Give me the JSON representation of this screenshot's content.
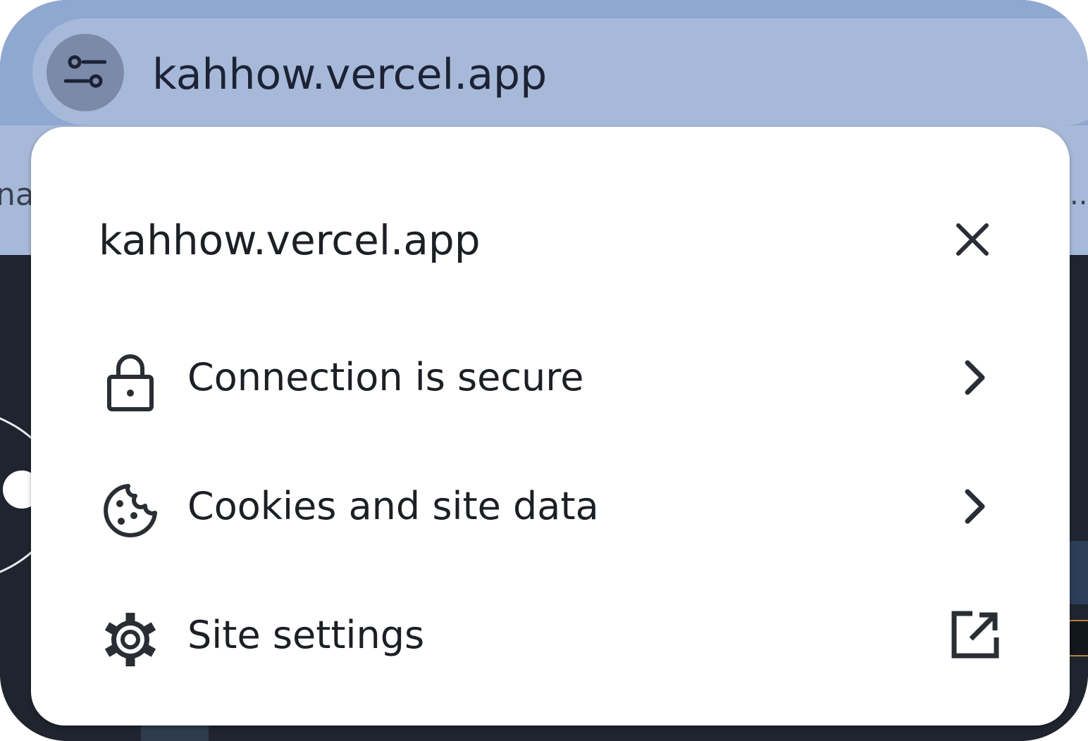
{
  "browser": {
    "omnibox": {
      "url": "kahhow.vercel.app",
      "site_info_icon": "tune-icon"
    },
    "bookmarks_fragment_left": "nat",
    "bookmarks_fragment_right": "..."
  },
  "site_info_popup": {
    "title": "kahhow.vercel.app",
    "close_icon": "close-icon",
    "items": [
      {
        "label": "Connection is secure",
        "icon": "lock-icon",
        "trailing_icon": "chevron-right-icon"
      },
      {
        "label": "Cookies and site data",
        "icon": "cookie-icon",
        "trailing_icon": "chevron-right-icon"
      },
      {
        "label": "Site settings",
        "icon": "gear-icon",
        "trailing_icon": "open-in-new-icon"
      }
    ]
  },
  "colors": {
    "chrome_band": "#8fa8d2",
    "omnibox": "#a6b9d9",
    "site_info_chip": "#7c8aaa",
    "page_background": "#21252f",
    "popup_background": "#ffffff",
    "text": "#1c1f24"
  }
}
